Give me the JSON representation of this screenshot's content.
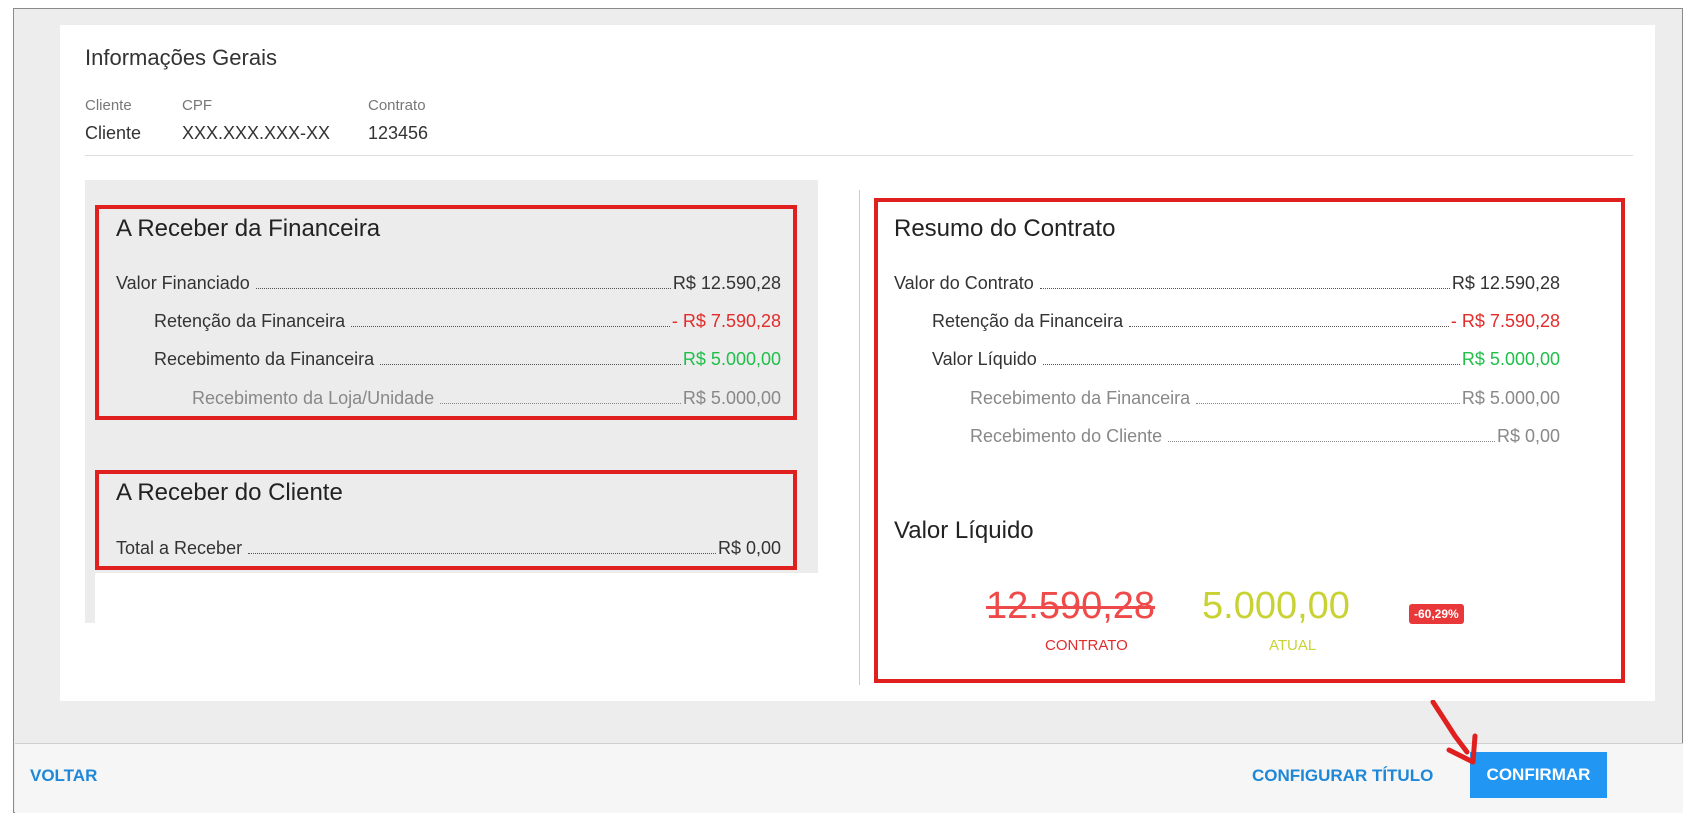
{
  "general_info": {
    "title": "Informações Gerais",
    "fields": [
      {
        "label": "Cliente",
        "value": "Cliente"
      },
      {
        "label": "CPF",
        "value": "XXX.XXX.XXX-XX"
      },
      {
        "label": "Contrato",
        "value": "123456"
      }
    ]
  },
  "receivable_financeira": {
    "title": "A Receber da Financeira",
    "rows": [
      {
        "label": "Valor Financiado",
        "value": "R$ 12.590,28"
      },
      {
        "label": "Retenção da Financeira",
        "value": "- R$ 7.590,28"
      },
      {
        "label": "Recebimento da Financeira",
        "value": "R$ 5.000,00"
      },
      {
        "label": "Recebimento da Loja/Unidade",
        "value": "R$ 5.000,00"
      }
    ]
  },
  "receivable_cliente": {
    "title": "A Receber do Cliente",
    "rows": [
      {
        "label": "Total a Receber",
        "value": "R$ 0,00"
      }
    ]
  },
  "contract_summary": {
    "title": "Resumo do Contrato",
    "rows": [
      {
        "label": "Valor do Contrato",
        "value": "R$ 12.590,28"
      },
      {
        "label": "Retenção da Financeira",
        "value": "- R$ 7.590,28"
      },
      {
        "label": "Valor Líquido",
        "value": "R$ 5.000,00"
      },
      {
        "label": "Recebimento da Financeira",
        "value": "R$ 5.000,00"
      },
      {
        "label": "Recebimento do Cliente",
        "value": "R$ 0,00"
      }
    ]
  },
  "net_value": {
    "title": "Valor Líquido",
    "contract_value": "12.590,28",
    "contract_caption": "CONTRATO",
    "current_value": "5.000,00",
    "current_caption": "ATUAL",
    "change_badge": "-60,29%"
  },
  "footer": {
    "back_label": "VOLTAR",
    "configure_label": "CONFIGURAR TÍTULO",
    "confirm_label": "CONFIRMAR"
  },
  "colors": {
    "negative": "#e22b2b",
    "positive": "#1fbf4a",
    "current": "#c9d233",
    "primary": "#2196f3",
    "highlight_box": "#e01f1f"
  }
}
